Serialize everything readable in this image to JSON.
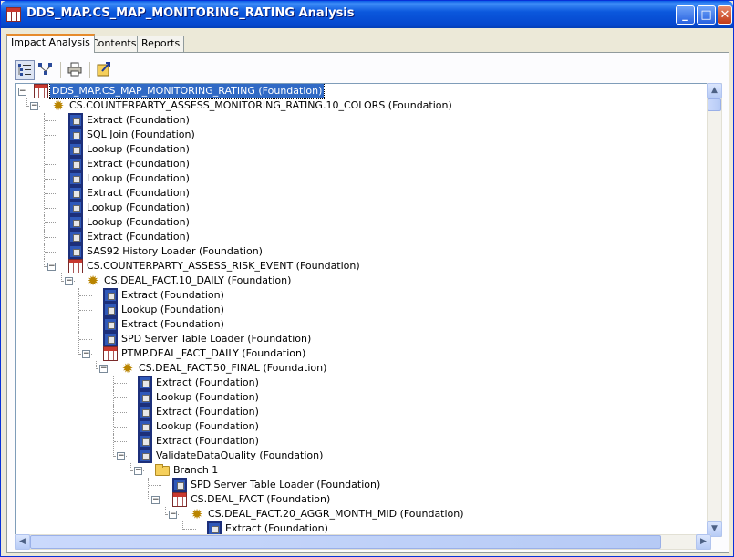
{
  "window": {
    "title": "DDS_MAP.CS_MAP_MONITORING_RATING Analysis",
    "controls": {
      "minimize": "_",
      "maximize": "□",
      "close": "✕"
    }
  },
  "tabs": [
    {
      "label": "Impact Analysis",
      "active": true
    },
    {
      "label": "Contents",
      "active": false
    },
    {
      "label": "Reports",
      "active": false
    }
  ],
  "toolbar": {
    "icons": [
      "tree-view-icon",
      "diagram-view-icon",
      "print-icon",
      "export-icon"
    ]
  },
  "tree": [
    {
      "label": "DDS_MAP.CS_MAP_MONITORING_RATING (Foundation)",
      "icon": "table",
      "level": 0,
      "expander": "⊟",
      "selected": true
    },
    {
      "label": "CS.COUNTERPARTY_ASSESS_MONITORING_RATING.10_COLORS (Foundation)",
      "icon": "job",
      "level": 1,
      "expander": "⊟"
    },
    {
      "label": "Extract (Foundation)",
      "icon": "transform",
      "level": 2
    },
    {
      "label": "SQL Join (Foundation)",
      "icon": "transform",
      "level": 2
    },
    {
      "label": "Lookup (Foundation)",
      "icon": "transform",
      "level": 2
    },
    {
      "label": "Extract (Foundation)",
      "icon": "transform",
      "level": 2
    },
    {
      "label": "Lookup (Foundation)",
      "icon": "transform",
      "level": 2
    },
    {
      "label": "Extract (Foundation)",
      "icon": "transform",
      "level": 2
    },
    {
      "label": "Lookup (Foundation)",
      "icon": "transform",
      "level": 2
    },
    {
      "label": "Lookup (Foundation)",
      "icon": "transform",
      "level": 2
    },
    {
      "label": "Extract (Foundation)",
      "icon": "transform",
      "level": 2
    },
    {
      "label": "SAS92 History Loader (Foundation)",
      "icon": "transform",
      "level": 2
    },
    {
      "label": "CS.COUNTERPARTY_ASSESS_RISK_EVENT (Foundation)",
      "icon": "table",
      "level": 2,
      "expander": "⊟"
    },
    {
      "label": "CS.DEAL_FACT.10_DAILY (Foundation)",
      "icon": "job",
      "level": 3,
      "expander": "⊟"
    },
    {
      "label": "Extract (Foundation)",
      "icon": "transform",
      "level": 4
    },
    {
      "label": "Lookup (Foundation)",
      "icon": "transform",
      "level": 4
    },
    {
      "label": "Extract (Foundation)",
      "icon": "transform",
      "level": 4
    },
    {
      "label": "SPD Server Table Loader (Foundation)",
      "icon": "transform",
      "level": 4
    },
    {
      "label": "PTMP.DEAL_FACT_DAILY (Foundation)",
      "icon": "table",
      "level": 4,
      "expander": "⊟"
    },
    {
      "label": "CS.DEAL_FACT.50_FINAL (Foundation)",
      "icon": "job",
      "level": 5,
      "expander": "⊟"
    },
    {
      "label": "Extract (Foundation)",
      "icon": "transform",
      "level": 6
    },
    {
      "label": "Lookup (Foundation)",
      "icon": "transform",
      "level": 6
    },
    {
      "label": "Extract (Foundation)",
      "icon": "transform",
      "level": 6
    },
    {
      "label": "Lookup (Foundation)",
      "icon": "transform",
      "level": 6
    },
    {
      "label": "Extract (Foundation)",
      "icon": "transform",
      "level": 6
    },
    {
      "label": "ValidateDataQuality (Foundation)",
      "icon": "transform",
      "level": 6,
      "expander": "⊟"
    },
    {
      "label": "Branch 1",
      "icon": "folder",
      "level": 7,
      "expander": "⊟"
    },
    {
      "label": "SPD Server Table Loader (Foundation)",
      "icon": "transform",
      "level": 8
    },
    {
      "label": "CS.DEAL_FACT (Foundation)",
      "icon": "table",
      "level": 8,
      "expander": "⊟"
    },
    {
      "label": "CS.DEAL_FACT.20_AGGR_MONTH_MID (Foundation)",
      "icon": "job",
      "level": 9,
      "expander": "⊟"
    },
    {
      "label": "Extract (Foundation)",
      "icon": "transform",
      "level": 10
    }
  ]
}
